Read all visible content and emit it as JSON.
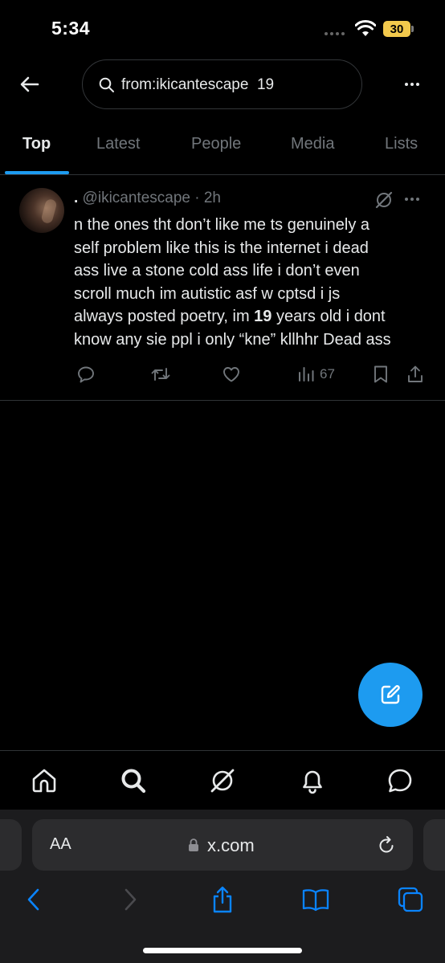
{
  "status_bar": {
    "time": "5:34",
    "battery_level": "30"
  },
  "search": {
    "query": "from:ikicantescape  19"
  },
  "tabs": [
    {
      "label": "Top",
      "active": true
    },
    {
      "label": "Latest",
      "active": false
    },
    {
      "label": "People",
      "active": false
    },
    {
      "label": "Media",
      "active": false
    },
    {
      "label": "Lists",
      "active": false
    }
  ],
  "tweet": {
    "display_name": ".",
    "handle_time": " @ikicantescape · 2h",
    "lines": [
      "n the ones tht don’t like me ts genuinely a",
      "self problem like this is the internet i dead",
      "ass live a stone cold ass life i don’t even",
      "scroll much im autistic asf w cptsd   i js"
    ],
    "line5_before": "always posted poetry, im ",
    "line5_bold": "19",
    "line5_after": " years old i dont",
    "line6": "know any sie ppl i only “kne” kllhhr Dead ass",
    "views": "67"
  },
  "browser": {
    "aa_label": "AA",
    "url": "x.com"
  },
  "colors": {
    "accent": "#1d9bf0",
    "background": "#000000",
    "battery": "#f2c94c"
  }
}
